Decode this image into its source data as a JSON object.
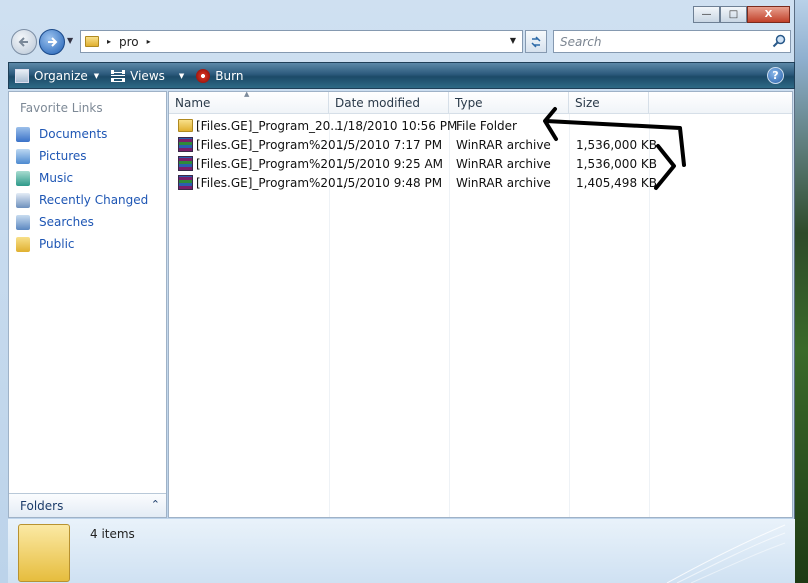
{
  "window": {
    "caption_minimize": "—",
    "caption_maximize": "□",
    "caption_close": "X"
  },
  "navbar": {
    "back_icon": "back-arrow-icon",
    "forward_icon": "forward-arrow-icon",
    "path_sep": "▸",
    "path": "pro",
    "path_tail": "▸",
    "search_placeholder": "Search"
  },
  "toolbar": {
    "organize": "Organize",
    "views": "Views",
    "burn": "Burn",
    "dropdown_glyph": "▼",
    "help": "?"
  },
  "sidebar": {
    "title": "Favorite Links",
    "items": [
      {
        "label": "Documents",
        "icon": "documents-icon",
        "color": "#3a72c8"
      },
      {
        "label": "Pictures",
        "icon": "pictures-icon",
        "color": "#4d8ad0"
      },
      {
        "label": "Music",
        "icon": "music-icon",
        "color": "#2e9a8a"
      },
      {
        "label": "Recently Changed",
        "icon": "recently-changed-icon",
        "color": "#6d90bd"
      },
      {
        "label": "Searches",
        "icon": "searches-icon",
        "color": "#5b87c0"
      },
      {
        "label": "Public",
        "icon": "public-folder-icon",
        "color": "#e0b030"
      }
    ],
    "folders_label": "Folders",
    "folders_chevron": "⌃"
  },
  "filelist": {
    "columns": [
      "Name",
      "Date modified",
      "Type",
      "Size"
    ],
    "sort_glyph": "▲",
    "rows": [
      {
        "name": "[Files.GE]_Program_20...",
        "date": "1/18/2010 10:56 PM",
        "type": "File Folder",
        "size": "",
        "icon": "folder-icon"
      },
      {
        "name": "[Files.GE]_Program%20...",
        "date": "1/5/2010 7:17 PM",
        "type": "WinRAR archive",
        "size": "1,536,000 KB",
        "icon": "winrar-archive-icon"
      },
      {
        "name": "[Files.GE]_Program%20...",
        "date": "1/5/2010 9:25 AM",
        "type": "WinRAR archive",
        "size": "1,536,000 KB",
        "icon": "winrar-archive-icon"
      },
      {
        "name": "[Files.GE]_Program%20...",
        "date": "1/5/2010 9:48 PM",
        "type": "WinRAR archive",
        "size": "1,405,498 KB",
        "icon": "winrar-archive-icon"
      }
    ]
  },
  "details": {
    "count": "4 items"
  },
  "colors": {
    "link": "#1e56b4",
    "toolbar": "#2c5a7c",
    "annotation": "#000000"
  }
}
